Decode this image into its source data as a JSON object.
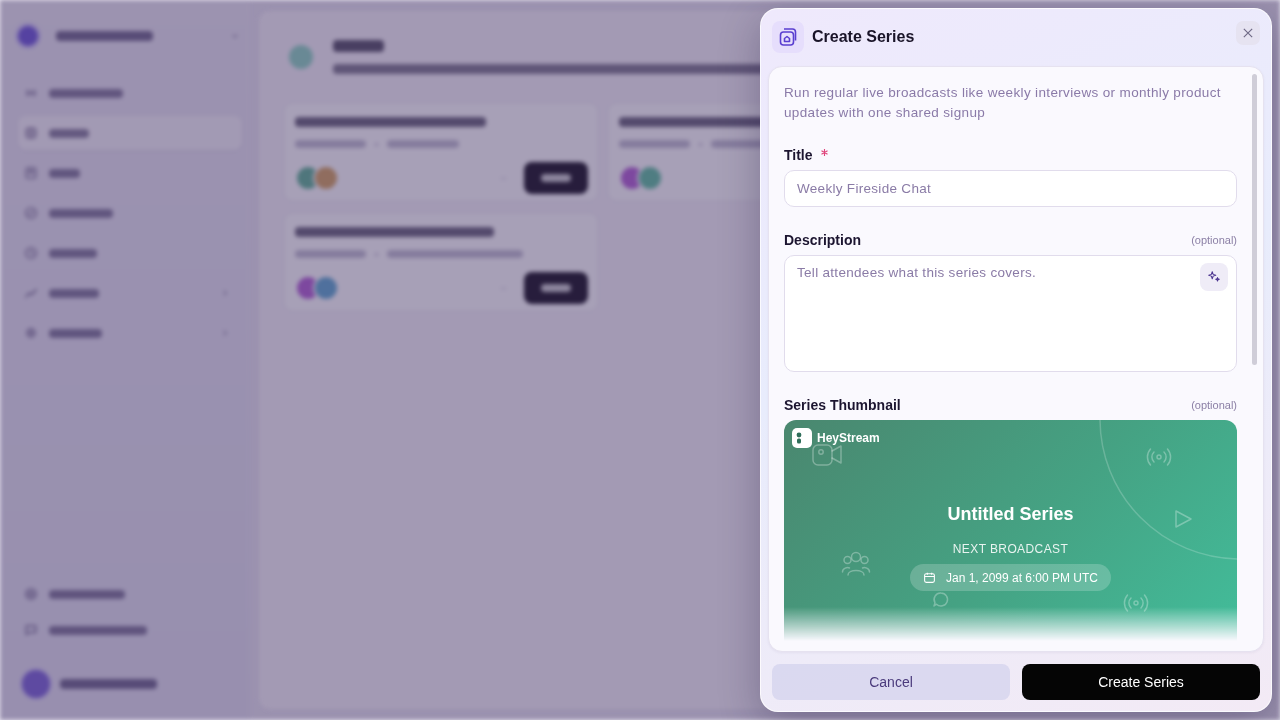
{
  "modal": {
    "title": "Create Series",
    "description": "Run regular live broadcasts like weekly interviews or monthly product updates with one shared signup",
    "fields": [
      {
        "kind": "text",
        "label": "Title",
        "required": true,
        "placeholder": "Weekly Fireside Chat"
      },
      {
        "kind": "textarea",
        "label": "Description",
        "required": false,
        "hint": "(optional)",
        "placeholder": "Tell attendees what this series covers."
      },
      {
        "kind": "thumbnail",
        "label": "Series Thumbnail",
        "required": false,
        "hint": "(optional)",
        "preview": {
          "brand": "HeyStream",
          "title": "Untitled Series",
          "caption": "NEXT BROADCAST",
          "date": "Jan 1, 2099 at 6:00 PM UTC"
        }
      }
    ],
    "buttons": [
      {
        "label": "Cancel",
        "kind": "secondary"
      },
      {
        "label": "Create Series",
        "kind": "primary"
      }
    ]
  }
}
